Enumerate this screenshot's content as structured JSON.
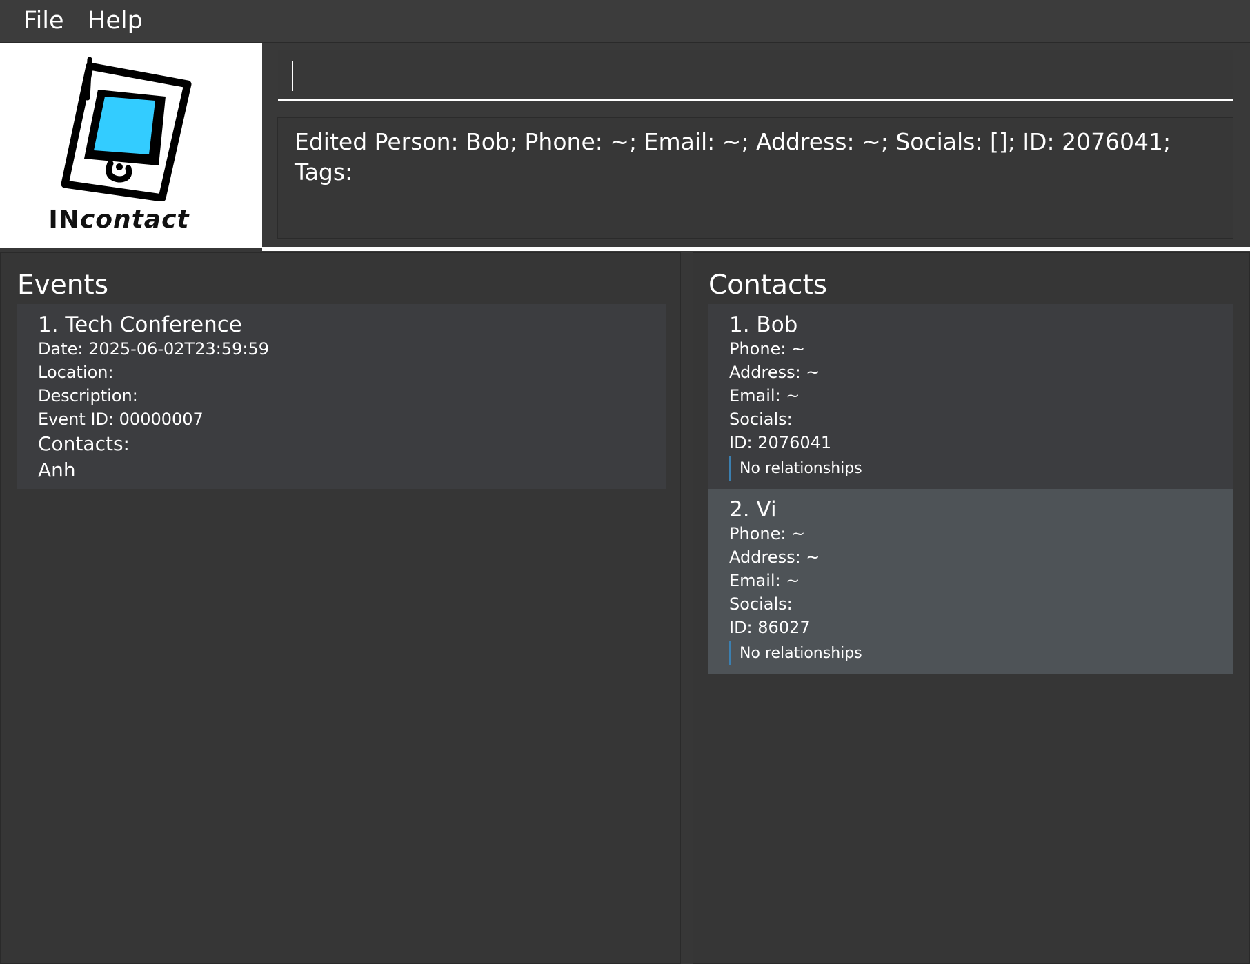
{
  "menu": {
    "file_label": "File",
    "help_label": "Help"
  },
  "logo": {
    "text_bold": "IN",
    "text_italic": "contact"
  },
  "command": {
    "value": "",
    "placeholder": ""
  },
  "result": {
    "message": "Edited Person: Bob; Phone: ~; Email: ~; Address: ~; Socials: []; ID: 2076041; Tags:"
  },
  "events": {
    "title": "Events",
    "items": [
      {
        "heading": "1.  Tech Conference",
        "date": "Date: 2025-06-02T23:59:59",
        "location": "Location:",
        "description": "Description:",
        "event_id": "Event ID: 00000007",
        "contacts_label": "Contacts:",
        "contacts": "Anh"
      }
    ]
  },
  "contacts": {
    "title": "Contacts",
    "items": [
      {
        "heading": "1. Bob",
        "phone": "Phone: ~",
        "address": "Address: ~",
        "email": "Email: ~",
        "socials": "Socials:",
        "id": "ID: 2076041",
        "relationships": "No relationships"
      },
      {
        "heading": "2. Vi",
        "phone": "Phone: ~",
        "address": "Address: ~",
        "email": "Email: ~",
        "socials": "Socials:",
        "id": "ID: 86027",
        "relationships": "No relationships"
      }
    ]
  },
  "colors": {
    "background": "#373737",
    "card": "#3c3d40",
    "card_selected": "#4e5357",
    "relationship_bar": "#3b7fb0",
    "logo_screen": "#33ccff"
  }
}
